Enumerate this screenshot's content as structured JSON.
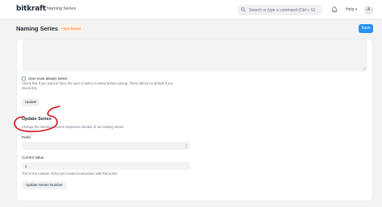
{
  "navbar": {
    "logo": "bitkraft",
    "breadcrumb": "Naming Series",
    "search_placeholder": "Search or type a command (Ctrl + G)",
    "help_label": "Help",
    "avatar_initial": "A"
  },
  "header": {
    "title": "Naming Series",
    "status_badge": "• Not Saved",
    "save_label": "Save"
  },
  "form": {
    "checkbox_label": "User must always select",
    "checkbox_help_line1": "Check this if you want to force the user to select a series before saving. There will be no default if you",
    "checkbox_help_line2": "check this.",
    "update_label": "Update",
    "section_title": "Update Series",
    "section_desc": "Change the starting / current sequence number of an existing series.",
    "prefix_label": "Prefix",
    "prefix_value": "",
    "current_value_label": "Current Value",
    "current_value": "1",
    "current_value_help": "This is the number of the last created transaction with this prefix",
    "update_series_button": "Update Series Number"
  },
  "colors": {
    "primary": "#2490ef",
    "badge_text": "#e86c13",
    "annotation": "#d4141e"
  }
}
